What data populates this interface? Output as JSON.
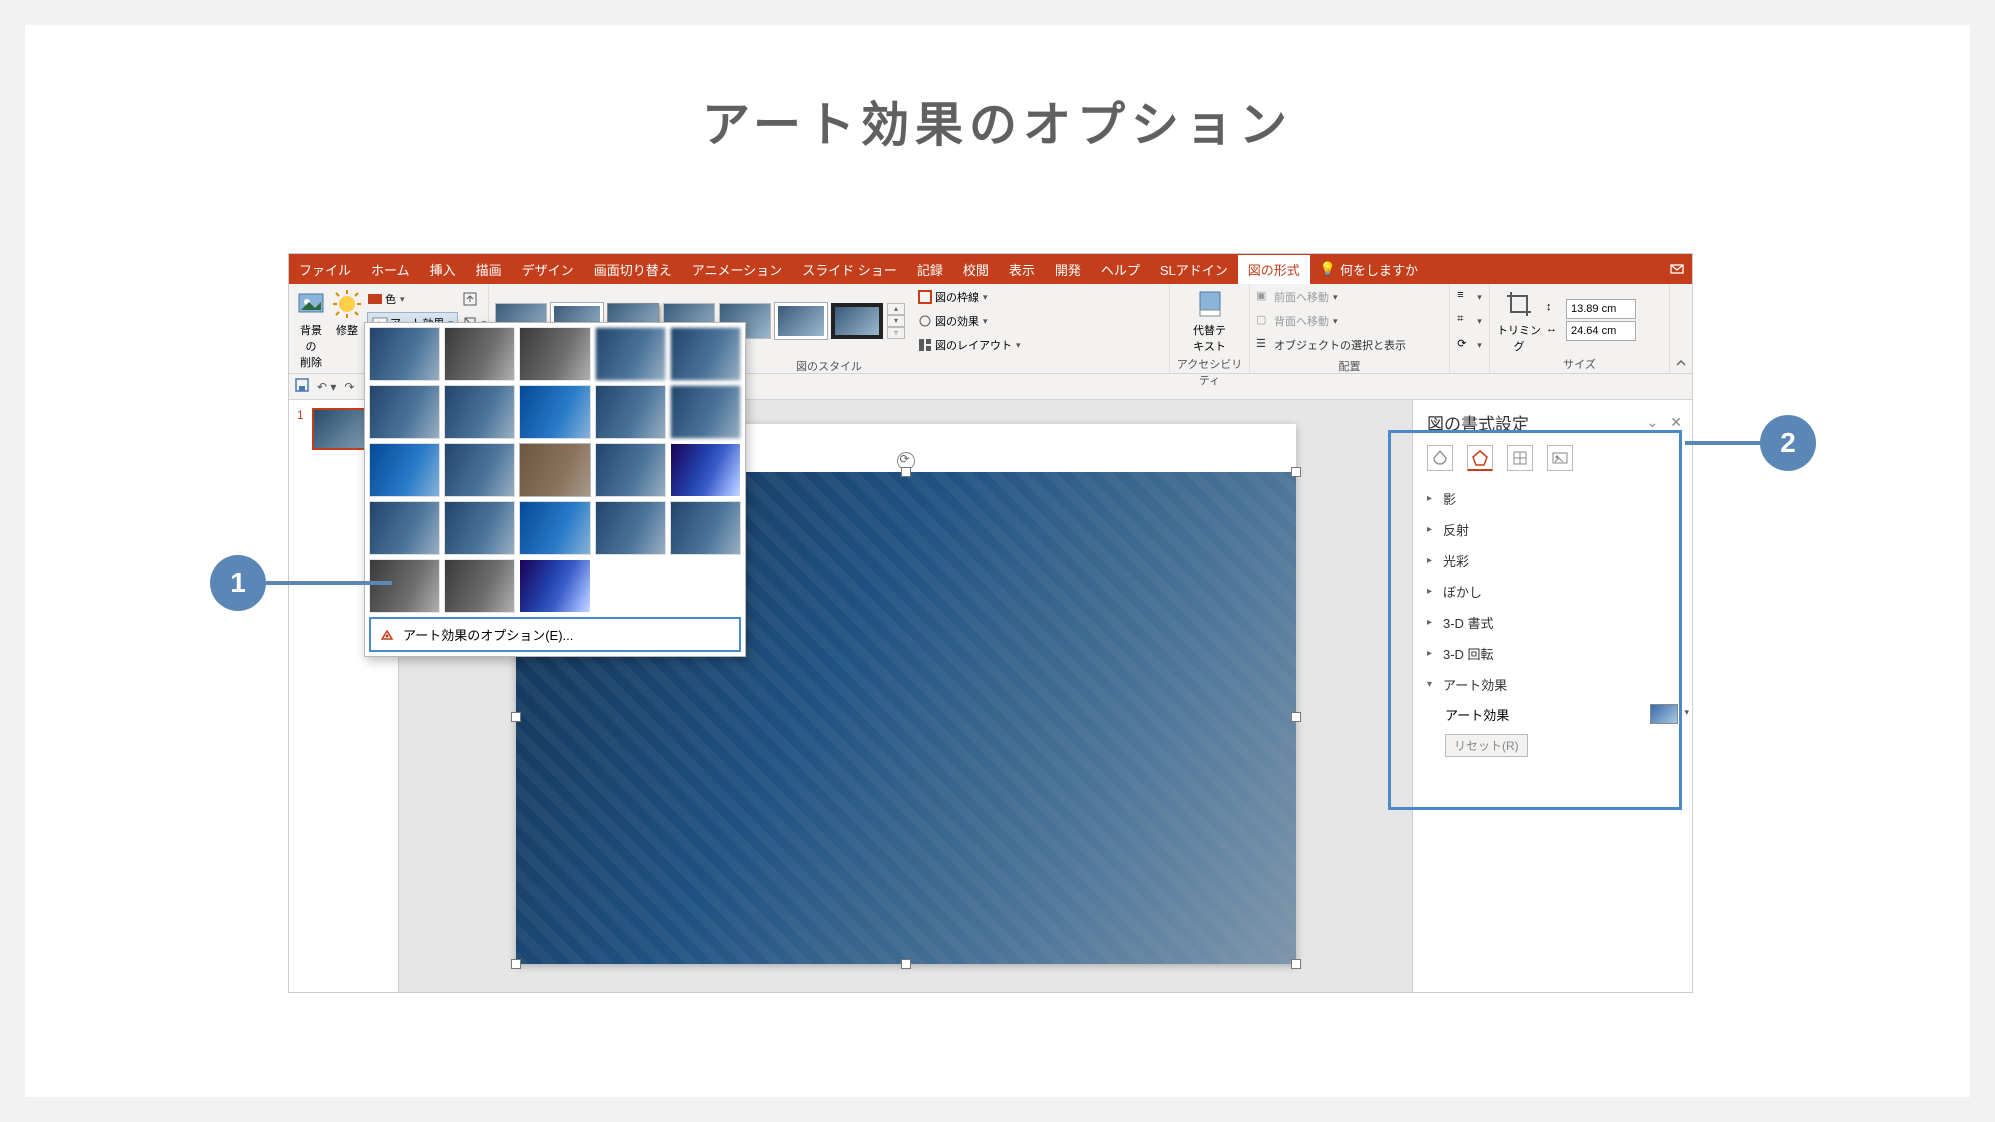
{
  "page": {
    "title": "アート効果のオプション"
  },
  "callouts": {
    "one": "1",
    "two": "2"
  },
  "ribbon": {
    "tabs": {
      "file": "ファイル",
      "home": "ホーム",
      "insert": "挿入",
      "draw": "描画",
      "design": "デザイン",
      "transitions": "画面切り替え",
      "animations": "アニメーション",
      "slideshow": "スライド ショー",
      "record": "記録",
      "review": "校閲",
      "view": "表示",
      "developer": "開発",
      "help": "ヘルプ",
      "sladdin": "SLアドイン",
      "picture_format": "図の形式",
      "tell_me": "何をしますか"
    },
    "groups": {
      "adjust": {
        "remove_bg": "背景の\n削除",
        "corrections": "修整",
        "color": "色",
        "artistic": "アート効果"
      },
      "styles": {
        "label": "図のスタイル",
        "border": "図の枠線",
        "effects": "図の効果",
        "layout": "図のレイアウト"
      },
      "accessibility": {
        "alt_text": "代替テ\nキスト",
        "label": "アクセシビリティ"
      },
      "arrange": {
        "bring_forward": "前面へ移動",
        "send_backward": "背面へ移動",
        "selection_pane": "オブジェクトの選択と表示",
        "label": "配置"
      },
      "size": {
        "crop": "トリミング",
        "height": "13.89 cm",
        "width": "24.64 cm",
        "label": "サイズ"
      }
    }
  },
  "art_popup": {
    "options_label": "アート効果のオプション(E)..."
  },
  "slides": {
    "first_index": "1"
  },
  "format_pane": {
    "title": "図の書式設定",
    "sections": {
      "shadow": "影",
      "reflection": "反射",
      "glow": "光彩",
      "soft_edges": "ぼかし",
      "format_3d": "3-D 書式",
      "rotation_3d": "3-D 回転",
      "artistic": "アート効果"
    },
    "artistic_label": "アート効果",
    "reset": "リセット(R)"
  }
}
